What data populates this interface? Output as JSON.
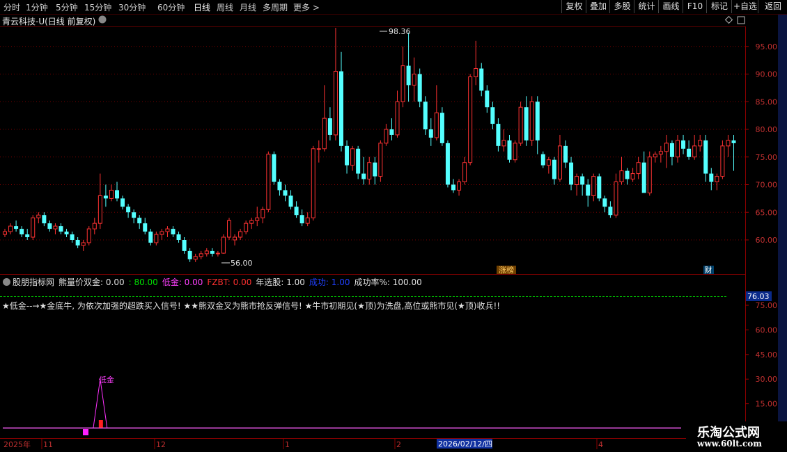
{
  "toolbar": {
    "periods": [
      "分时",
      "1分钟",
      "5分钟",
      "15分钟",
      "30分钟",
      "60分钟",
      "日线",
      "周线",
      "月线",
      "多周期",
      "更多 >"
    ],
    "active_period": "日线",
    "right_buttons": [
      "复权",
      "叠加",
      "多股",
      "统计",
      "画线",
      "F10",
      "标记",
      "+自选",
      "返回"
    ]
  },
  "chart_title": "青云科技-U(日线 前复权)",
  "main_chart": {
    "y_ticks": [
      "95.00",
      "90.00",
      "85.00",
      "80.00",
      "75.00",
      "70.00",
      "65.00",
      "60.00"
    ],
    "high_label": "98.36",
    "low_label": "56.00",
    "badge_zhangbang": "涨榜",
    "badge_cai": "财"
  },
  "indicator": {
    "name": "股朋指标网",
    "items": [
      {
        "label": "熊量价双金: 0.00",
        "color": "#e0e0e0"
      },
      {
        "label": ": 80.00",
        "color": "#00e000"
      },
      {
        "label": "低金: 0.00",
        "color": "#ff40ff"
      },
      {
        "label": "FZBT: 0.00",
        "color": "#ff3030"
      },
      {
        "label": "年选股: 1.00",
        "color": "#e0e0e0"
      },
      {
        "label": "成功: 1.00",
        "color": "#2040ff"
      },
      {
        "label": "成功率%: 100.00",
        "color": "#e0e0e0"
      }
    ],
    "message": "★低金--→★金底牛, 为依次加强的超跌买入信号! ★★熊双金叉为熊市抢反弹信号! ★牛市初期见(★顶)为洗盘,高位或熊市见(★顶)收兵!!",
    "y_ticks": [
      "75.00",
      "60.00",
      "45.00",
      "30.00",
      "15.00"
    ],
    "current_value": "76.03",
    "signal_label": "低金"
  },
  "date_axis": {
    "year_label": "2025年",
    "months": [
      "11",
      "12",
      "1",
      "2",
      "4"
    ],
    "highlight_date": "2026/02/12/四"
  },
  "watermark": {
    "line1": "乐淘公式网",
    "line2": "www.60lt.com"
  },
  "chart_data": {
    "type": "candlestick",
    "title": "青云科技-U(日线 前复权)",
    "ylim": [
      55,
      100
    ],
    "up_color": "#ff3232",
    "down_color": "#54ffff",
    "candles": [
      [
        61,
        62,
        60.5,
        61.5
      ],
      [
        61.5,
        63,
        61,
        62.5
      ],
      [
        62.5,
        63.5,
        61.5,
        62
      ],
      [
        62,
        62.5,
        60.5,
        61
      ],
      [
        61,
        62,
        60,
        60.5
      ],
      [
        60.5,
        64.5,
        60,
        64
      ],
      [
        64,
        65,
        63,
        64.5
      ],
      [
        64.5,
        65,
        62.5,
        63
      ],
      [
        63,
        63.5,
        61.5,
        62
      ],
      [
        62,
        63,
        61,
        62.5
      ],
      [
        62.5,
        63,
        61,
        61.5
      ],
      [
        61.5,
        62,
        60.5,
        61
      ],
      [
        61,
        61.5,
        59.5,
        60
      ],
      [
        60,
        60.5,
        58.5,
        59
      ],
      [
        59,
        60,
        58,
        59.5
      ],
      [
        59.5,
        62.5,
        59,
        62
      ],
      [
        62,
        64,
        61,
        63
      ],
      [
        63,
        72,
        62,
        68
      ],
      [
        68,
        70,
        66,
        67.5
      ],
      [
        67.5,
        70,
        67,
        69
      ],
      [
        69,
        70.5,
        67,
        67.5
      ],
      [
        67.5,
        68,
        65.5,
        66
      ],
      [
        66,
        66.5,
        64,
        65
      ],
      [
        65,
        65.5,
        63,
        64
      ],
      [
        64,
        64.5,
        62,
        63
      ],
      [
        63,
        64,
        61,
        61.5
      ],
      [
        61.5,
        62,
        59,
        59.5
      ],
      [
        59.5,
        61.5,
        59,
        61
      ],
      [
        61,
        62,
        60,
        61.5
      ],
      [
        61.5,
        62.5,
        60.5,
        62
      ],
      [
        62,
        62.5,
        60.5,
        61
      ],
      [
        61,
        61.5,
        59.5,
        60
      ],
      [
        60,
        60.5,
        57.5,
        58
      ],
      [
        58,
        58.5,
        56,
        56.5
      ],
      [
        56.5,
        57.5,
        56,
        57
      ],
      [
        57,
        58,
        56.5,
        57.5
      ],
      [
        57.5,
        58.5,
        57,
        58
      ],
      [
        58,
        58.5,
        57,
        57.5
      ],
      [
        57.5,
        58,
        57,
        57.6
      ],
      [
        57.6,
        61,
        57.5,
        60.5
      ],
      [
        60.5,
        64,
        60,
        63.5
      ],
      [
        60,
        61,
        59,
        60.5
      ],
      [
        60.5,
        62,
        60,
        61.5
      ],
      [
        61.5,
        63.5,
        61,
        63
      ],
      [
        63,
        64,
        62,
        63.5
      ],
      [
        63.5,
        66,
        62.5,
        64
      ],
      [
        64,
        66,
        63,
        65.5
      ],
      [
        65.5,
        76,
        65,
        75.5
      ],
      [
        75.5,
        76,
        70,
        70.5
      ],
      [
        70.5,
        71,
        68,
        69
      ],
      [
        69,
        70,
        67,
        68
      ],
      [
        68,
        69,
        65.5,
        66
      ],
      [
        66,
        67,
        64,
        64.5
      ],
      [
        64.5,
        65.5,
        62.5,
        63
      ],
      [
        63,
        65,
        62.5,
        64
      ],
      [
        64,
        77,
        63.5,
        76.5
      ],
      [
        76.5,
        78,
        74,
        76.5
      ],
      [
        76.5,
        88,
        76,
        82
      ],
      [
        82,
        84,
        78,
        79
      ],
      [
        79,
        98.36,
        78,
        90.5
      ],
      [
        90.5,
        94,
        76,
        77
      ],
      [
        77,
        78,
        72,
        73.5
      ],
      [
        73.5,
        77,
        72.5,
        76.5
      ],
      [
        76.5,
        77,
        71,
        72
      ],
      [
        72,
        75,
        70,
        71
      ],
      [
        71,
        75,
        70,
        74
      ],
      [
        74,
        75,
        70,
        71.5
      ],
      [
        71.5,
        78,
        70.5,
        77.5
      ],
      [
        77.5,
        81,
        77,
        80
      ],
      [
        80,
        82,
        78,
        79
      ],
      [
        79,
        87,
        78.5,
        85
      ],
      [
        85,
        95,
        84,
        91.5
      ],
      [
        91.5,
        97.5,
        85,
        88
      ],
      [
        88,
        93,
        85,
        90
      ],
      [
        90,
        91,
        84,
        85
      ],
      [
        85,
        86,
        79,
        80
      ],
      [
        80,
        82,
        77,
        78.5
      ],
      [
        78.5,
        88,
        78,
        83
      ],
      [
        83,
        84,
        77,
        77.5
      ],
      [
        77.5,
        78,
        69.5,
        70
      ],
      [
        70,
        71,
        68.5,
        69
      ],
      [
        69,
        71,
        68,
        70.5
      ],
      [
        70.5,
        75,
        70,
        74
      ],
      [
        74,
        90,
        73.5,
        89.5
      ],
      [
        89.5,
        96,
        88,
        91
      ],
      [
        91,
        92,
        86,
        87
      ],
      [
        87,
        88,
        83,
        84
      ],
      [
        84,
        85,
        80,
        81
      ],
      [
        81,
        82,
        76,
        77
      ],
      [
        77,
        80,
        76,
        78
      ],
      [
        78,
        79,
        74,
        74.5
      ],
      [
        74.5,
        78,
        74,
        77.5
      ],
      [
        77.5,
        85,
        77,
        84
      ],
      [
        84,
        86,
        77,
        78
      ],
      [
        78,
        86,
        77,
        85
      ],
      [
        85,
        86,
        75.5,
        78
      ],
      [
        75.5,
        76,
        73,
        73.5
      ],
      [
        73.5,
        75,
        72,
        74.5
      ],
      [
        74.5,
        75,
        70,
        71
      ],
      [
        71,
        79,
        70.5,
        77
      ],
      [
        77,
        78,
        73,
        74
      ],
      [
        74,
        75,
        69,
        70
      ],
      [
        70,
        72,
        68,
        71.5
      ],
      [
        71.5,
        72,
        68,
        70
      ],
      [
        70,
        71,
        66,
        68
      ],
      [
        68,
        72,
        67,
        71.5
      ],
      [
        71.5,
        72,
        67,
        67.5
      ],
      [
        67.5,
        68,
        65,
        66
      ],
      [
        66,
        67,
        64,
        64.5
      ],
      [
        64.5,
        72,
        64,
        70.5
      ],
      [
        70.5,
        75,
        70,
        72.5
      ],
      [
        72.5,
        73,
        70,
        71
      ],
      [
        71,
        73,
        70.5,
        72
      ],
      [
        72,
        75,
        71,
        74
      ],
      [
        74,
        76,
        70,
        68.5
      ],
      [
        68.5,
        76,
        68,
        75
      ],
      [
        75,
        76,
        74,
        75.5
      ],
      [
        75.5,
        77,
        74,
        76
      ],
      [
        76,
        79,
        73,
        77.5
      ],
      [
        77.5,
        78,
        73.5,
        75
      ],
      [
        75,
        79,
        74,
        78
      ],
      [
        78,
        79,
        75.5,
        76.5
      ],
      [
        76.5,
        78,
        74.5,
        75
      ],
      [
        75,
        79,
        74.5,
        77
      ],
      [
        77,
        79,
        76,
        78
      ],
      [
        78,
        79,
        70.5,
        72
      ],
      [
        72,
        73,
        69,
        70.5
      ],
      [
        70.5,
        72,
        69,
        71.5
      ],
      [
        71.5,
        78,
        71,
        77
      ],
      [
        77,
        79,
        75,
        78
      ],
      [
        78,
        79,
        72.5,
        77.5
      ]
    ],
    "indicator_series": {
      "name": "低金",
      "signal_index": 17,
      "signal_value": 30
    }
  }
}
